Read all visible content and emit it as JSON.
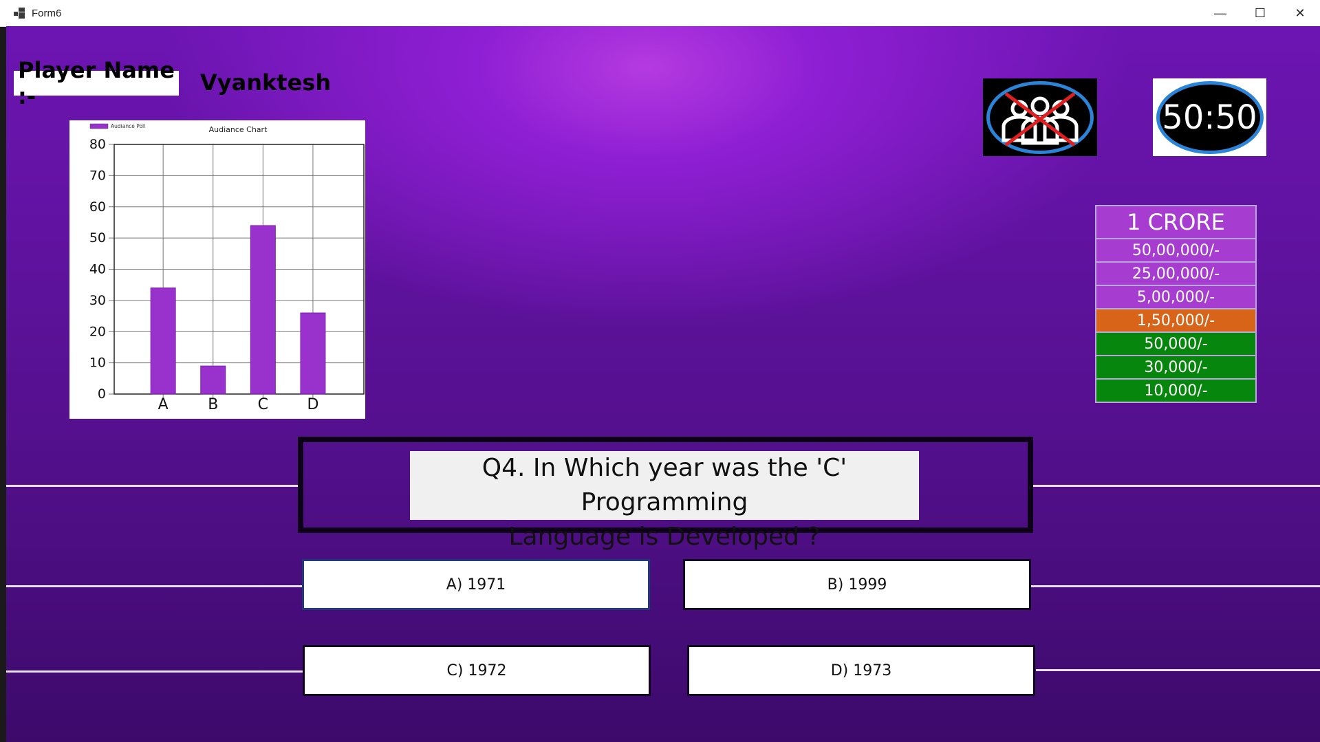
{
  "window": {
    "title": "Form6",
    "controls": [
      "—",
      "☐",
      "✕"
    ]
  },
  "player": {
    "label": "Player Name :-",
    "name": "Vyanktesh"
  },
  "lifelines": {
    "fifty_fifty": "50:50"
  },
  "prize_ladder": [
    {
      "amount": "1 CRORE",
      "status": "purple"
    },
    {
      "amount": "50,00,000/-",
      "status": "purple"
    },
    {
      "amount": "25,00,000/-",
      "status": "purple"
    },
    {
      "amount": "5,00,000/-",
      "status": "purple"
    },
    {
      "amount": "1,50,000/-",
      "status": "orange"
    },
    {
      "amount": "50,000/-",
      "status": "green"
    },
    {
      "amount": "30,000/-",
      "status": "green"
    },
    {
      "amount": "10,000/-",
      "status": "green"
    }
  ],
  "question": {
    "line1": "Q4. In Which year was the 'C' Programming",
    "line2": "Language is Developed ?"
  },
  "options": {
    "a": "A) 1971",
    "b": "B) 1999",
    "c": "C) 1972",
    "d": "D) 1973"
  },
  "colors": {
    "bar": "#9932cc",
    "ladder_purple": "#a63dd0",
    "ladder_orange": "#d76418",
    "ladder_green": "#06860c",
    "lifeline_ring": "#2b84d8"
  },
  "chart_data": {
    "type": "bar",
    "title": "Audiance Chart",
    "legend": "Audiance Poll",
    "categories": [
      "A",
      "B",
      "C",
      "D"
    ],
    "series": [
      {
        "name": "Audiance Poll",
        "values": [
          34,
          9,
          54,
          26
        ]
      }
    ],
    "yticks": [
      0,
      10,
      20,
      30,
      40,
      50,
      60,
      70,
      80
    ],
    "ylim": [
      0,
      80
    ],
    "grid": true,
    "legend_position": "top-left"
  }
}
